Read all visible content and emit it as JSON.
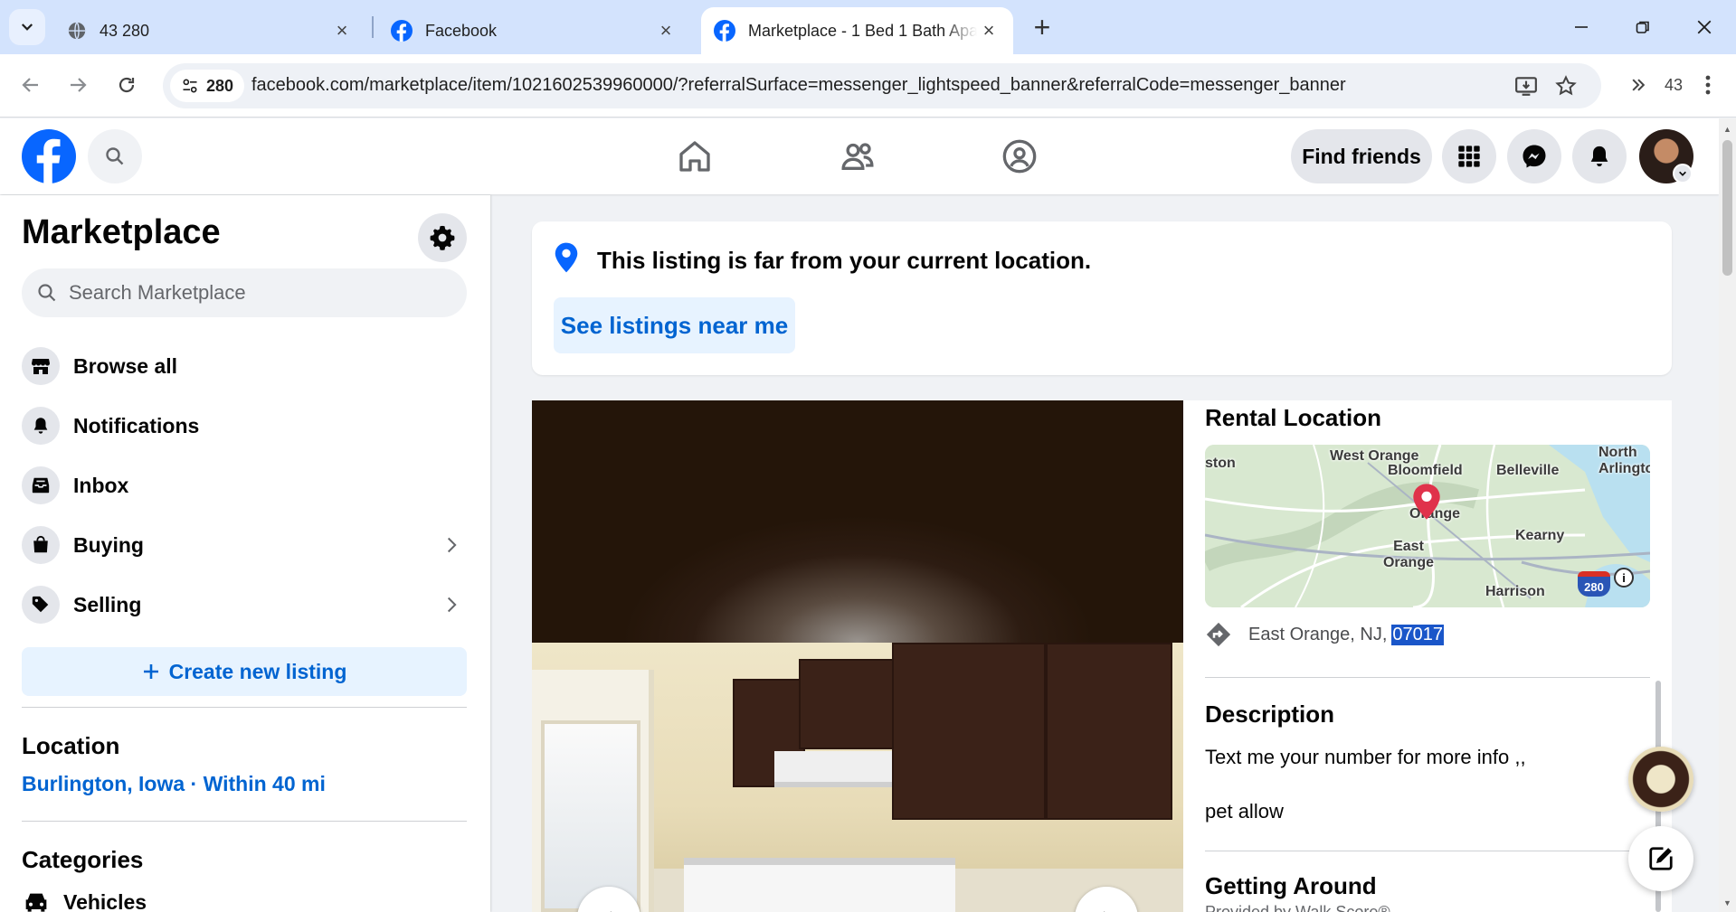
{
  "browser": {
    "tabs": [
      {
        "title": "43 280",
        "icon": "globe-icon"
      },
      {
        "title": "Facebook",
        "icon": "facebook-icon"
      },
      {
        "title": "Marketplace - 1 Bed 1 Bath Apa",
        "icon": "facebook-icon",
        "active": true
      }
    ],
    "site_chip": "280",
    "url": "facebook.com/marketplace/item/1021602539960000/?referralSurface=messenger_lightspeed_banner&referralCode=messenger_banner",
    "extension_count": "43"
  },
  "header": {
    "find_friends": "Find friends"
  },
  "sidebar": {
    "title": "Marketplace",
    "search_placeholder": "Search Marketplace",
    "items": [
      {
        "label": "Browse all",
        "icon": "storefront-icon"
      },
      {
        "label": "Notifications",
        "icon": "bell-icon"
      },
      {
        "label": "Inbox",
        "icon": "inbox-icon"
      },
      {
        "label": "Buying",
        "icon": "shopping-bag-icon",
        "chevron": true
      },
      {
        "label": "Selling",
        "icon": "tag-icon",
        "chevron": true
      }
    ],
    "create_listing": "Create new listing",
    "location_heading": "Location",
    "location_value": "Burlington, Iowa · Within 40 mi",
    "categories_heading": "Categories",
    "categories": [
      {
        "label": "Vehicles",
        "icon": "car-icon"
      }
    ]
  },
  "notice": {
    "text": "This listing is far from your current location.",
    "button": "See listings near me"
  },
  "details": {
    "rental_location_heading": "Rental Location",
    "map_labels": [
      "ston",
      "West Orange",
      "Bloomfield",
      "Belleville",
      "North Arlingto",
      "Orange",
      "East Orange",
      "Kearny",
      "Harrison",
      "280"
    ],
    "address_prefix": "East Orange, NJ, ",
    "address_zip": "07017",
    "description_heading": "Description",
    "description_line1": "Text me your number  for more info ,,",
    "description_line2": "pet allow",
    "getting_around_heading": "Getting Around",
    "getting_around_sub": "Provided by Walk Score®"
  },
  "colors": {
    "accent": "#0866ff",
    "link": "#0064d1",
    "tab_strip": "#d3e3fd",
    "selection": "#1a56c9"
  }
}
